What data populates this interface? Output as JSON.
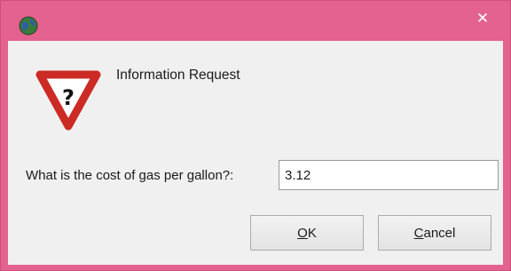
{
  "window": {
    "icon": "app-globe-icon",
    "close_icon": "close-icon",
    "close_glyph": "✕",
    "frame_color": "#e3628f"
  },
  "dialog": {
    "icon": "question-warning-icon",
    "icon_glyph": "?",
    "title": "Information Request",
    "prompt": "What is the cost of gas per gallon?:",
    "input_value": "3.12",
    "ok_mnemonic": "O",
    "ok_rest": "K",
    "cancel_mnemonic": "C",
    "cancel_rest": "ancel"
  }
}
